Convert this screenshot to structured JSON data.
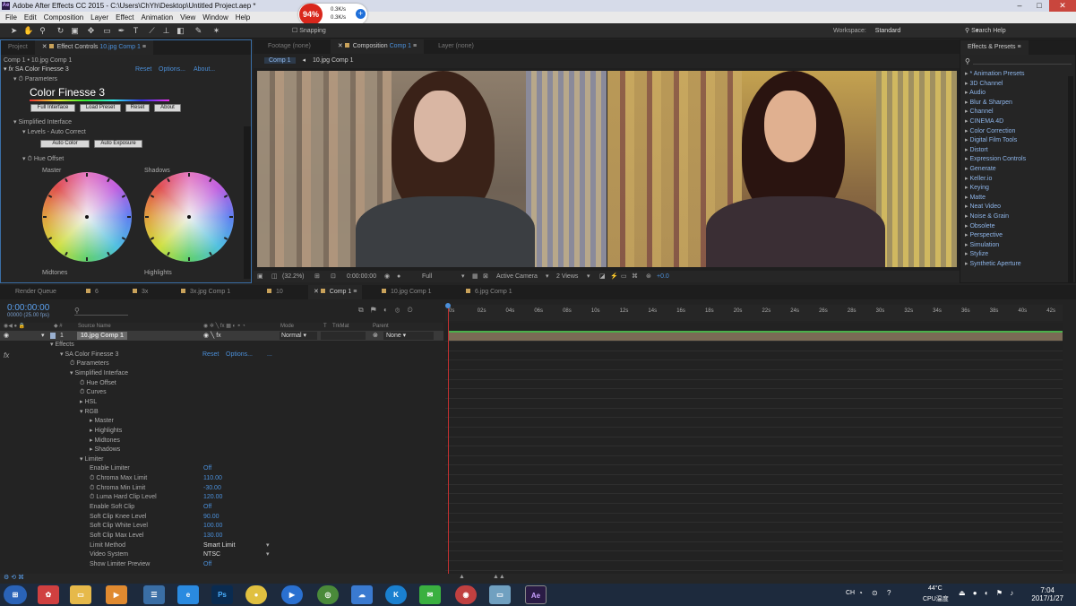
{
  "window": {
    "title": "Adobe After Effects CC 2015 - C:\\Users\\ChYh\\Desktop\\Untitled Project.aep *"
  },
  "menu": [
    "File",
    "Edit",
    "Composition",
    "Layer",
    "Effect",
    "Animation",
    "View",
    "Window",
    "Help"
  ],
  "netmon": {
    "percent": "94%",
    "up": "0.3K/s",
    "down": "0.3K/s"
  },
  "toolbar": {
    "snapping": "Snapping",
    "workspace_label": "Workspace:",
    "workspace_value": "Standard",
    "search_help": "Search Help"
  },
  "left_panel": {
    "tabs": [
      "Project",
      "Effect Controls",
      "10.jpg Comp 1"
    ],
    "breadcrumb": "Comp 1 • 10.jpg Comp 1",
    "effect_name": "SA Color Finesse 3",
    "effect_links": [
      "Reset",
      "Options...",
      "About..."
    ],
    "parameters": "Parameters",
    "brand": "Color Finesse 3",
    "buttons": [
      "Full Interface",
      "Load Preset",
      "Reset",
      "About"
    ],
    "simplified": "Simplified Interface",
    "levels": "Levels - Auto Correct",
    "auto_buttons": [
      "Auto Color",
      "Auto Exposure"
    ],
    "hue_offset": "Hue Offset",
    "wheels": [
      "Master",
      "Shadows",
      "Midtones",
      "Highlights"
    ]
  },
  "comp_panel": {
    "tabs": [
      "Footage (none)",
      "Composition",
      "Comp 1",
      "Layer (none)"
    ],
    "crumbs": [
      "Comp 1",
      "10.jpg Comp 1"
    ],
    "zoom": "(32.2%)",
    "time": "0:00:00:00",
    "resolution": "Full",
    "camera": "Active Camera",
    "views": "2 Views",
    "exposure": "+0.0"
  },
  "effects_presets": {
    "title": "Effects & Presets",
    "items": [
      "* Animation Presets",
      "3D Channel",
      "Audio",
      "Blur & Sharpen",
      "Channel",
      "CINEMA 4D",
      "Color Correction",
      "Digital Film Tools",
      "Distort",
      "Expression Controls",
      "Generate",
      "Keller.io",
      "Keying",
      "Matte",
      "Neat Video",
      "Noise & Grain",
      "Obsolete",
      "Perspective",
      "Simulation",
      "Stylize",
      "Synthetic Aperture"
    ]
  },
  "timeline": {
    "tabs": [
      "Render Queue",
      "6",
      "3x",
      "3x.jpg Comp 1",
      "10",
      "Comp 1",
      "10.jpg Comp 1",
      "6.jpg Comp 1"
    ],
    "timecode": "0:00:00:00",
    "fps": "00000 (25.00 fps)",
    "headers": [
      "Source Name",
      "Mode",
      "T",
      "TrkMat",
      "Parent"
    ],
    "layer": {
      "num": "1",
      "name": "10.jpg Comp 1",
      "mode": "Normal",
      "parent": "None"
    },
    "ruler": [
      "0s",
      "02s",
      "04s",
      "06s",
      "08s",
      "10s",
      "12s",
      "14s",
      "16s",
      "18s",
      "20s",
      "22s",
      "24s",
      "26s",
      "28s",
      "30s",
      "32s",
      "34s",
      "36s",
      "38s",
      "40s",
      "42s"
    ],
    "props": [
      {
        "label": "Effects",
        "val": "",
        "indent": 1
      },
      {
        "label": "SA Color Finesse 3",
        "val": "",
        "indent": 2
      },
      {
        "label": "Parameters",
        "val": "",
        "indent": 3
      },
      {
        "label": "Simplified Interface",
        "val": "",
        "indent": 3
      },
      {
        "label": "Hue Offset",
        "val": "",
        "indent": 4
      },
      {
        "label": "Curves",
        "val": "",
        "indent": 4
      },
      {
        "label": "HSL",
        "val": "",
        "indent": 4
      },
      {
        "label": "RGB",
        "val": "",
        "indent": 4
      },
      {
        "label": "Master",
        "val": "",
        "indent": 5
      },
      {
        "label": "Highlights",
        "val": "",
        "indent": 5
      },
      {
        "label": "Midtones",
        "val": "",
        "indent": 5
      },
      {
        "label": "Shadows",
        "val": "",
        "indent": 5
      },
      {
        "label": "Limiter",
        "val": "",
        "indent": 4
      },
      {
        "label": "Enable Limiter",
        "val": "Off",
        "indent": 5
      },
      {
        "label": "Chroma Max Limit",
        "val": "110.00",
        "indent": 5
      },
      {
        "label": "Chroma Min Limit",
        "val": "-30.00",
        "indent": 5
      },
      {
        "label": "Luma Hard Clip Level",
        "val": "120.00",
        "indent": 5
      },
      {
        "label": "Enable Soft Clip",
        "val": "Off",
        "indent": 5
      },
      {
        "label": "Soft Clip Knee Level",
        "val": "90.00",
        "indent": 5
      },
      {
        "label": "Soft Clip White Level",
        "val": "100.00",
        "indent": 5
      },
      {
        "label": "Soft Clip Max Level",
        "val": "130.00",
        "indent": 5
      },
      {
        "label": "Limit Method",
        "val": "Smart Limit",
        "indent": 5
      },
      {
        "label": "Video System",
        "val": "NTSC",
        "indent": 5
      },
      {
        "label": "Show Limiter Preview",
        "val": "Off",
        "indent": 5
      }
    ],
    "fx_links": [
      "Reset",
      "Options...",
      "..."
    ]
  },
  "taskbar": {
    "temp": "44°C",
    "cpu": "CPU温度",
    "time": "7:04",
    "date": "2017/1/27",
    "ime": "CH"
  }
}
